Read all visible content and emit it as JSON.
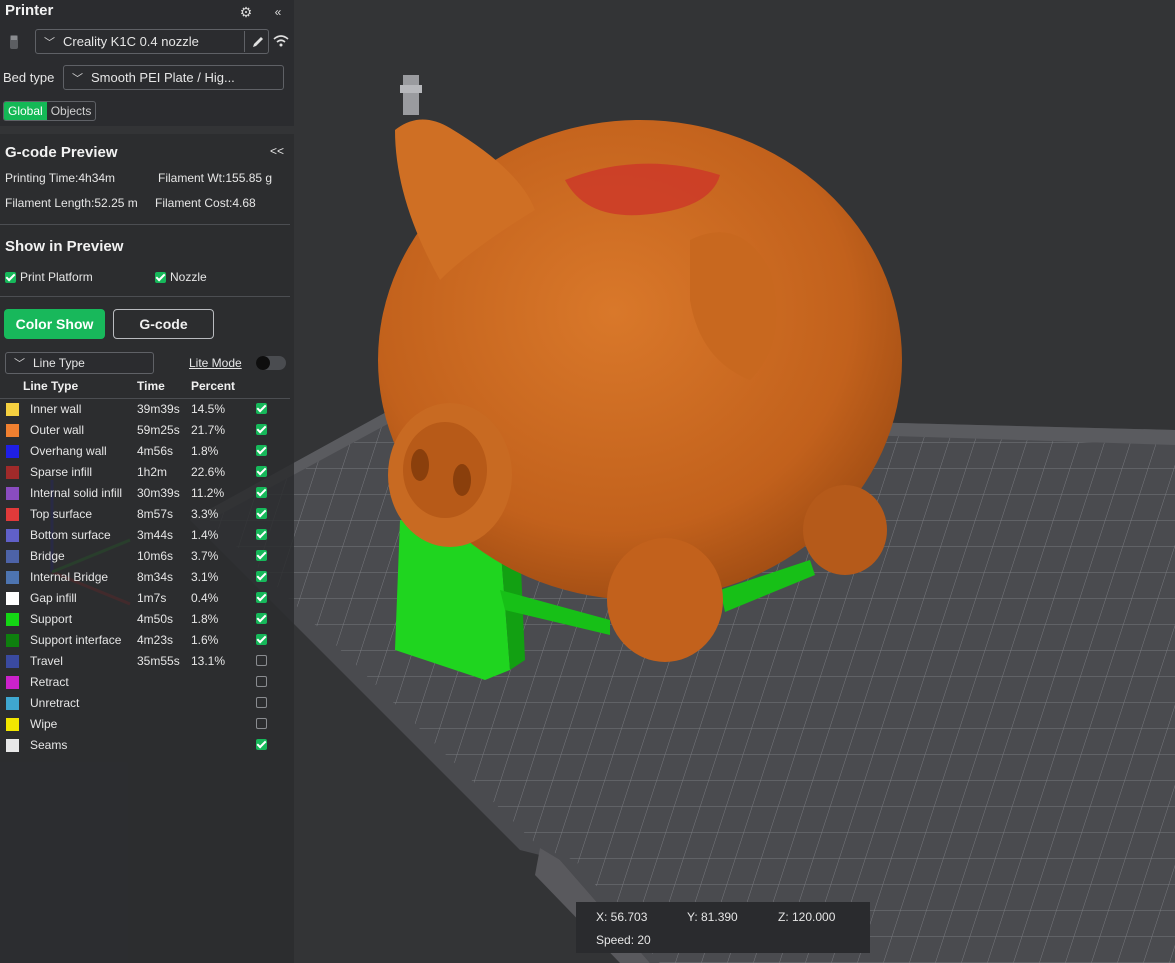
{
  "printer": {
    "title": "Printer",
    "printer_name": "Creality K1C 0.4 nozzle",
    "bed_type_label": "Bed type",
    "bed_type": "Smooth PEI Plate / Hig...",
    "tabs": [
      "Global",
      "Objects"
    ]
  },
  "preview": {
    "title": "G-code Preview",
    "collapse": "<<",
    "printing_time": "Printing Time:4h34m",
    "filament_wt": "Filament Wt:155.85 g",
    "filament_length": "Filament Length:52.25 m",
    "filament_cost": "Filament Cost:4.68",
    "show_title": "Show in Preview",
    "print_platform": "Print Platform",
    "nozzle": "Nozzle",
    "color_show": "Color Show",
    "gcode": "G-code",
    "view_select": "Line Type",
    "lite_mode": "Lite Mode",
    "columns": [
      "Line Type",
      "Time",
      "Percent"
    ]
  },
  "line_types": [
    {
      "name": "Inner wall",
      "time": "39m39s",
      "percent": "14.5%",
      "color": "#f5d040",
      "checked": true
    },
    {
      "name": "Outer wall",
      "time": "59m25s",
      "percent": "21.7%",
      "color": "#f08030",
      "checked": true
    },
    {
      "name": "Overhang wall",
      "time": "4m56s",
      "percent": "1.8%",
      "color": "#1f1fe6",
      "checked": true
    },
    {
      "name": "Sparse infill",
      "time": "1h2m",
      "percent": "22.6%",
      "color": "#a02a2a",
      "checked": true
    },
    {
      "name": "Internal solid infill",
      "time": "30m39s",
      "percent": "11.2%",
      "color": "#8a4cc0",
      "checked": true
    },
    {
      "name": "Top surface",
      "time": "8m57s",
      "percent": "3.3%",
      "color": "#e03a3a",
      "checked": true
    },
    {
      "name": "Bottom surface",
      "time": "3m44s",
      "percent": "1.4%",
      "color": "#6060c8",
      "checked": true
    },
    {
      "name": "Bridge",
      "time": "10m6s",
      "percent": "3.7%",
      "color": "#4d63a8",
      "checked": true
    },
    {
      "name": "Internal Bridge",
      "time": "8m34s",
      "percent": "3.1%",
      "color": "#4d74b0",
      "checked": true
    },
    {
      "name": "Gap infill",
      "time": "1m7s",
      "percent": "0.4%",
      "color": "#ffffff",
      "checked": true
    },
    {
      "name": "Support",
      "time": "4m50s",
      "percent": "1.8%",
      "color": "#14d614",
      "checked": true
    },
    {
      "name": "Support interface",
      "time": "4m23s",
      "percent": "1.6%",
      "color": "#0e7f0e",
      "checked": true
    },
    {
      "name": "Travel",
      "time": "35m55s",
      "percent": "13.1%",
      "color": "#3a4aa0",
      "checked": false
    },
    {
      "name": "Retract",
      "time": "",
      "percent": "",
      "color": "#cc22cc",
      "checked": false
    },
    {
      "name": "Unretract",
      "time": "",
      "percent": "",
      "color": "#3fa7d0",
      "checked": false
    },
    {
      "name": "Wipe",
      "time": "",
      "percent": "",
      "color": "#f2e600",
      "checked": false
    },
    {
      "name": "Seams",
      "time": "",
      "percent": "",
      "color": "#e8e8e8",
      "checked": true
    }
  ],
  "coords": {
    "x": "X: 56.703",
    "y": "Y: 81.390",
    "z": "Z: 120.000",
    "speed": "Speed: 20"
  }
}
